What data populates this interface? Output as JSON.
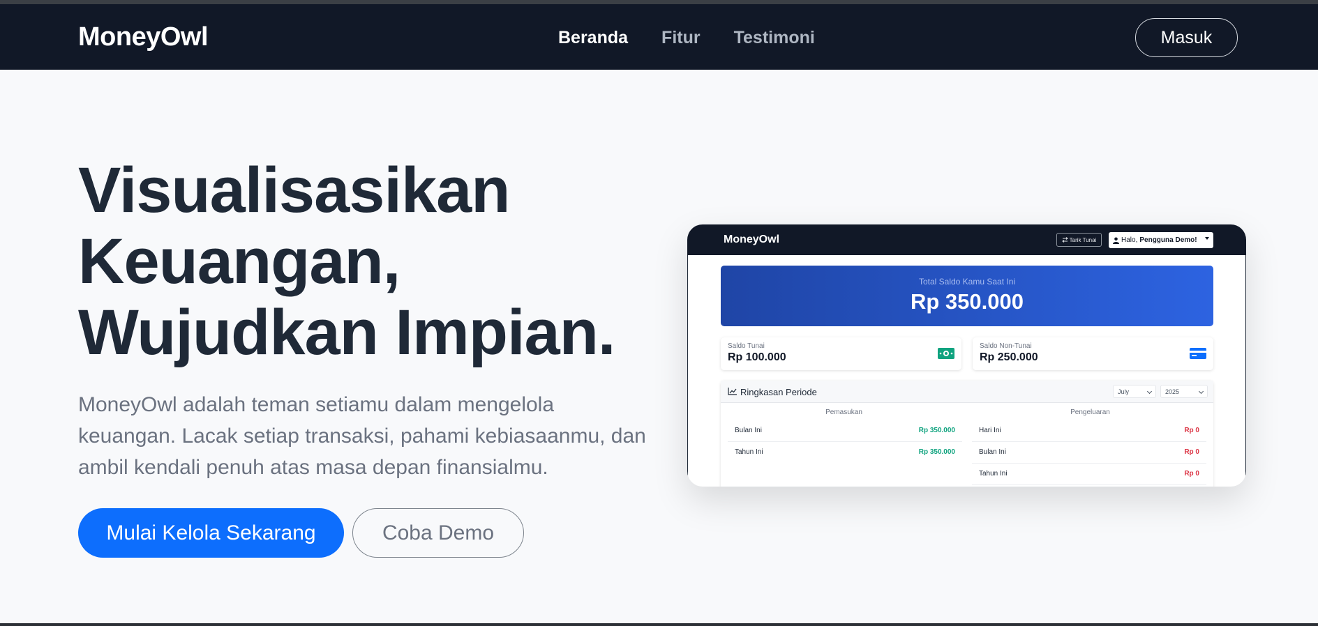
{
  "navbar": {
    "brand": "MoneyOwl",
    "links": [
      {
        "label": "Beranda",
        "active": true
      },
      {
        "label": "Fitur",
        "active": false
      },
      {
        "label": "Testimoni",
        "active": false
      }
    ],
    "login_label": "Masuk"
  },
  "hero": {
    "title_lines": [
      "Visualisasikan",
      "Keuangan,",
      "Wujudkan Impian."
    ],
    "description": "MoneyOwl adalah teman setiamu dalam mengelola keuangan. Lacak setiap transaksi, pahami kebiasaanmu, dan ambil kendali penuh atas masa depan finansialmu.",
    "primary_button": "Mulai Kelola Sekarang",
    "secondary_button": "Coba Demo"
  },
  "mockup": {
    "brand": "MoneyOwl",
    "tarik_label": "Tarik Tunai",
    "greeting": "Halo,",
    "user_name": "Pengguna Demo!",
    "total_label": "Total Saldo Kamu Saat Ini",
    "total_value": "Rp 350.000",
    "cash": {
      "label": "Saldo Tunai",
      "value": "Rp 100.000",
      "icon": "cash-icon"
    },
    "noncash": {
      "label": "Saldo Non-Tunai",
      "value": "Rp 250.000",
      "icon": "credit-card-icon"
    },
    "summary": {
      "title": "Ringkasan Periode",
      "month": "July",
      "year": "2025",
      "income": {
        "header": "Pemasukan",
        "rows": [
          {
            "label": "Bulan Ini",
            "value": "Rp 350.000"
          },
          {
            "label": "Tahun Ini",
            "value": "Rp 350.000"
          }
        ]
      },
      "expense": {
        "header": "Pengeluaran",
        "rows": [
          {
            "label": "Hari Ini",
            "value": "Rp 0"
          },
          {
            "label": "Bulan Ini",
            "value": "Rp 0"
          },
          {
            "label": "Tahun Ini",
            "value": "Rp 0"
          }
        ]
      }
    }
  },
  "colors": {
    "navbar_bg": "#111827",
    "primary": "#0d6efd",
    "income": "#10a37f",
    "expense": "#dc3545"
  }
}
